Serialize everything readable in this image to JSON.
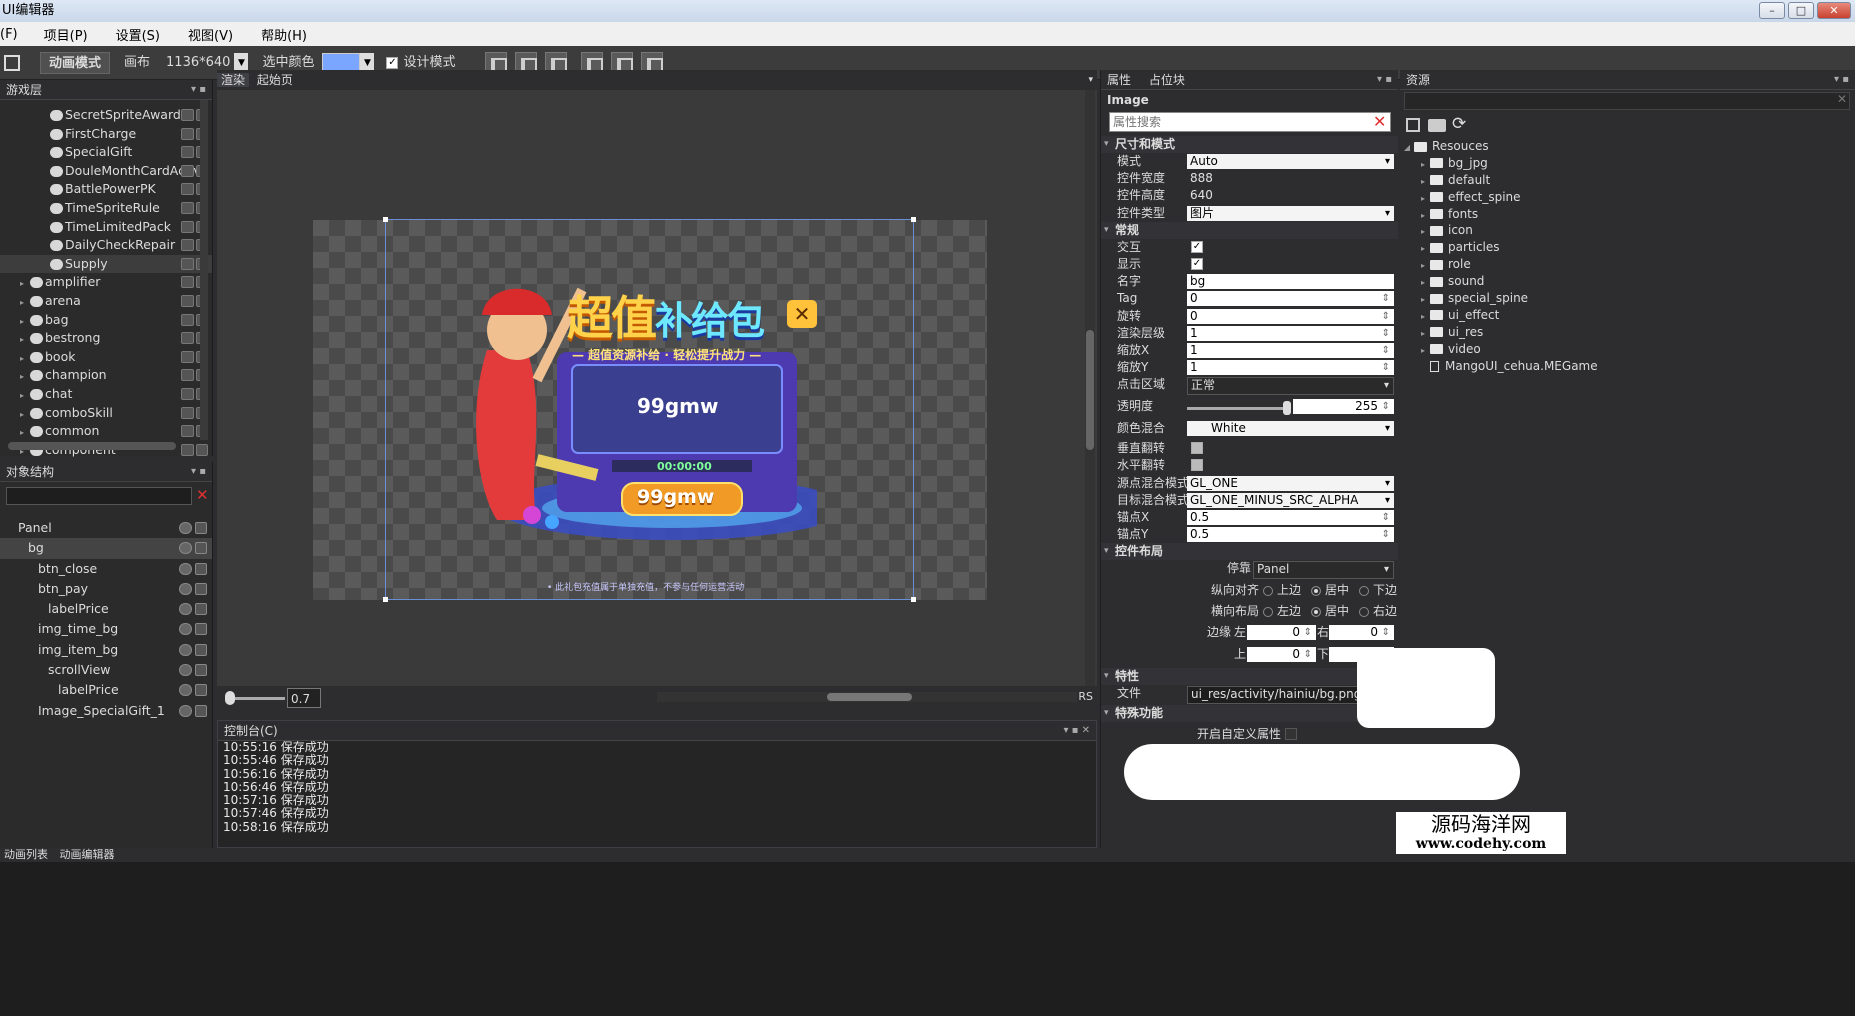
{
  "window": {
    "title": "UI编辑器"
  },
  "menu": [
    "(F)",
    "项目(P)",
    "设置(S)",
    "视图(V)",
    "帮助(H)"
  ],
  "toolbar": {
    "mode": "动画模式",
    "canvas_label": "画布",
    "canvas_size": "1136*640",
    "select_color_label": "选中颜色",
    "design_mode_label": "设计模式",
    "design_mode_checked": "✓",
    "select_color": "#7aa6ff"
  },
  "game_layer": {
    "title": "游戏层",
    "items": [
      {
        "label": "SecretSpriteAward",
        "indent": 2
      },
      {
        "label": "FirstCharge",
        "indent": 2
      },
      {
        "label": "SpecialGift",
        "indent": 2
      },
      {
        "label": "DouleMonthCardActiv",
        "indent": 2
      },
      {
        "label": "BattlePowerPK",
        "indent": 2
      },
      {
        "label": "TimeSpriteRule",
        "indent": 2
      },
      {
        "label": "TimeLimitedPack",
        "indent": 2
      },
      {
        "label": "DailyCheckRepair",
        "indent": 2
      },
      {
        "label": "Supply",
        "indent": 2,
        "selected": true
      },
      {
        "label": "amplifier",
        "indent": 1
      },
      {
        "label": "arena",
        "indent": 1
      },
      {
        "label": "bag",
        "indent": 1
      },
      {
        "label": "bestrong",
        "indent": 1
      },
      {
        "label": "book",
        "indent": 1
      },
      {
        "label": "champion",
        "indent": 1
      },
      {
        "label": "chat",
        "indent": 1
      },
      {
        "label": "comboSkill",
        "indent": 1
      },
      {
        "label": "common",
        "indent": 1
      },
      {
        "label": "component",
        "indent": 1
      }
    ]
  },
  "object_structure": {
    "title": "对象结构",
    "items": [
      {
        "label": "Panel",
        "indent": 0
      },
      {
        "label": "bg",
        "indent": 1,
        "selected": true
      },
      {
        "label": "btn_close",
        "indent": 2
      },
      {
        "label": "btn_pay",
        "indent": 2
      },
      {
        "label": "labelPrice",
        "indent": 3
      },
      {
        "label": "img_time_bg",
        "indent": 2
      },
      {
        "label": "img_item_bg",
        "indent": 2
      },
      {
        "label": "scrollView",
        "indent": 3
      },
      {
        "label": "labelPrice",
        "indent": 4
      },
      {
        "label": "Image_SpecialGift_1",
        "indent": 2
      }
    ]
  },
  "center": {
    "tabs": [
      "渲染",
      "起始页"
    ],
    "zoom": "0.7",
    "rs": "RS",
    "art": {
      "title_a": "超值",
      "title_b": "补给包",
      "subtitle": "— 超值资源补给 · 轻松提升战力 —",
      "price": "99gmw",
      "timer": "00:00:00",
      "button": "99gmw",
      "footer": "• 此礼包充值属于单独充值，不参与任何运营活动"
    }
  },
  "console": {
    "title": "控制台(C)",
    "lines": [
      "10:55:16 保存成功",
      "10:55:46 保存成功",
      "10:56:16 保存成功",
      "10:56:46 保存成功",
      "10:57:16 保存成功",
      "10:57:46 保存成功",
      "10:58:16 保存成功"
    ]
  },
  "properties": {
    "tabs": [
      "属性",
      "占位块"
    ],
    "heading": "Image",
    "search_placeholder": "属性搜索",
    "sec_size": "尺寸和模式",
    "mode_label": "模式",
    "mode_value": "Auto",
    "width_label": "控件宽度",
    "width_value": "888",
    "height_label": "控件高度",
    "height_value": "640",
    "type_label": "控件类型",
    "type_value": "图片",
    "sec_common": "常规",
    "interact_label": "交互",
    "interact_checked": "✓",
    "visible_label": "显示",
    "visible_checked": "✓",
    "name_label": "名字",
    "name_value": "bg",
    "tag_label": "Tag",
    "tag_value": "0",
    "rotate_label": "旋转",
    "rotate_value": "0",
    "zorder_label": "渲染层级",
    "zorder_value": "1",
    "scalex_label": "缩放X",
    "scalex_value": "1",
    "scaley_label": "缩放Y",
    "scaley_value": "1",
    "hit_label": "点击区域",
    "hit_value": "正常",
    "opacity_label": "透明度",
    "opacity_value": "255",
    "opacity_level": 1.0,
    "blendcolor_label": "颜色混合",
    "blendcolor_value": "White",
    "flipv_label": "垂直翻转",
    "fliph_label": "水平翻转",
    "src_blend_label": "源点混合模式",
    "src_blend_value": "GL_ONE",
    "dst_blend_label": "目标混合模式",
    "dst_blend_value": "GL_ONE_MINUS_SRC_ALPHA",
    "anchorx_label": "锚点X",
    "anchorx_value": "0.5",
    "anchory_label": "锚点Y",
    "anchory_value": "0.5",
    "sec_layout": "控件布局",
    "dock_label": "停靠",
    "dock_value": "Panel",
    "valign_label": "纵向对齐",
    "valign_opts": [
      "上边",
      "居中",
      "下边"
    ],
    "halign_label": "横向布局",
    "halign_opts": [
      "左边",
      "居中",
      "右边"
    ],
    "margin_label": "边缘",
    "m_left": "左",
    "m_left_v": "0",
    "m_right": "右",
    "m_right_v": "0",
    "m_top": "上",
    "m_top_v": "0",
    "m_bottom": "下",
    "sec_feature": "特性",
    "file_label": "文件",
    "file_value": "ui_res/activity/hainiu/bg.png",
    "sec_special": "特殊功能",
    "custom_attr_label": "开启自定义属性"
  },
  "resources": {
    "title": "资源",
    "root": "Resouces",
    "folders": [
      "bg_jpg",
      "default",
      "effect_spine",
      "fonts",
      "icon",
      "particles",
      "role",
      "sound",
      "special_spine",
      "ui_effect",
      "ui_res",
      "video"
    ],
    "file": "MangoUI_cehua.MEGame"
  },
  "status": {
    "tabs": [
      "动画列表",
      "动画编辑器"
    ]
  },
  "watermark": {
    "line1": "源码海洋网",
    "line2": "www.codehy.com"
  }
}
